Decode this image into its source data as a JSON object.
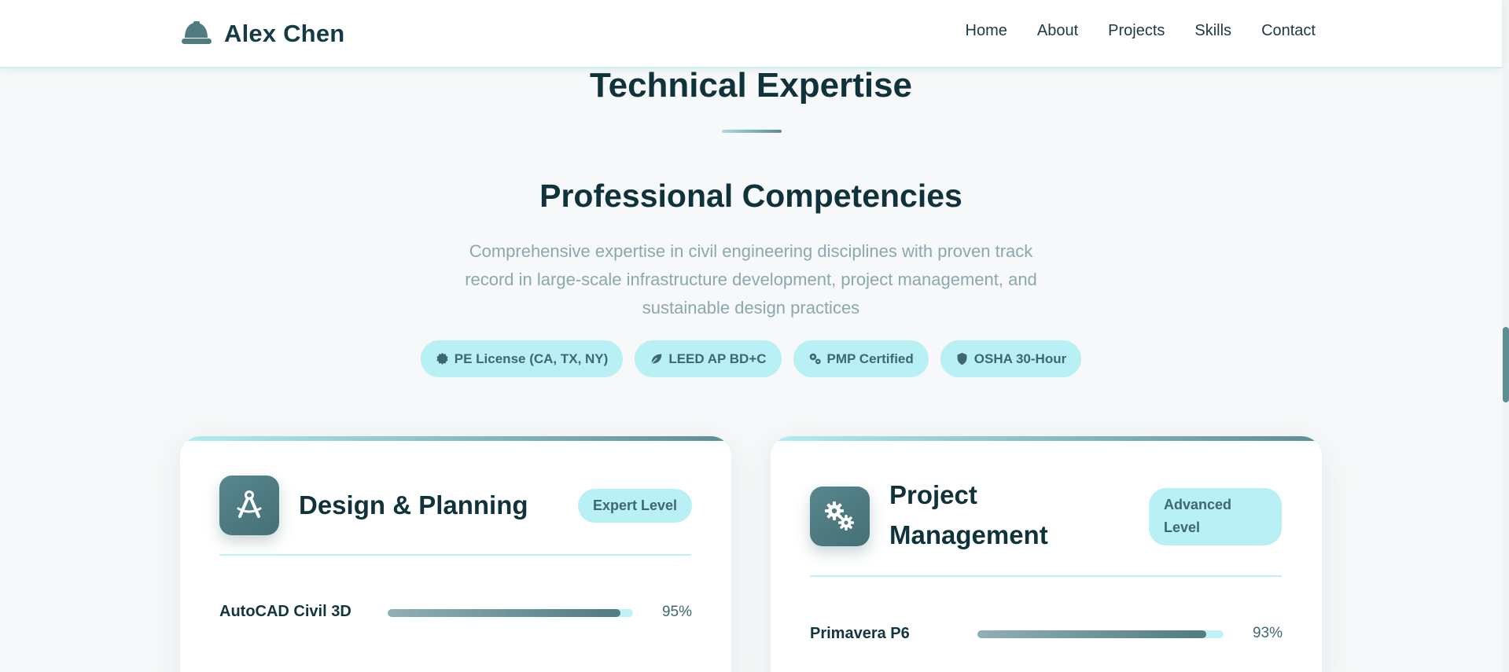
{
  "navbar": {
    "brand_name": "Alex Chen",
    "brand_icon": "hard-hat-icon",
    "links": [
      "Home",
      "About",
      "Projects",
      "Skills",
      "Contact"
    ]
  },
  "section": {
    "title": "Technical Expertise",
    "subtitle": "Professional Competencies",
    "description": "Comprehensive expertise in civil engineering disciplines with proven track record in large-scale infrastructure development, project management, and sustainable design practices"
  },
  "badges": [
    {
      "label": "PE License (CA, TX, NY)",
      "icon": "certificate-icon"
    },
    {
      "label": "LEED AP BD+C",
      "icon": "leaf-icon"
    },
    {
      "label": "PMP Certified",
      "icon": "cogs-icon"
    },
    {
      "label": "OSHA 30-Hour",
      "icon": "shield-icon"
    }
  ],
  "cards": [
    {
      "title": "Design & Planning",
      "level": "Expert Level",
      "icon": "drafting-compass-icon",
      "skills": [
        {
          "name": "AutoCAD Civil 3D",
          "percent_label": "95%",
          "level": 0.95
        }
      ]
    },
    {
      "title_line1": "Project",
      "title_line2": "Management",
      "level_line1": "Advanced",
      "level_line2": "Level",
      "icon": "cogs-icon",
      "skills": [
        {
          "name": "Primavera P6",
          "percent_label": "93%",
          "level": 0.93
        }
      ]
    }
  ],
  "colors": {
    "accent": "#b8f0f5",
    "primary": "#4f7b81",
    "text": "#10323a",
    "muted": "#8aa9ad",
    "background": "#f6f8f9"
  }
}
